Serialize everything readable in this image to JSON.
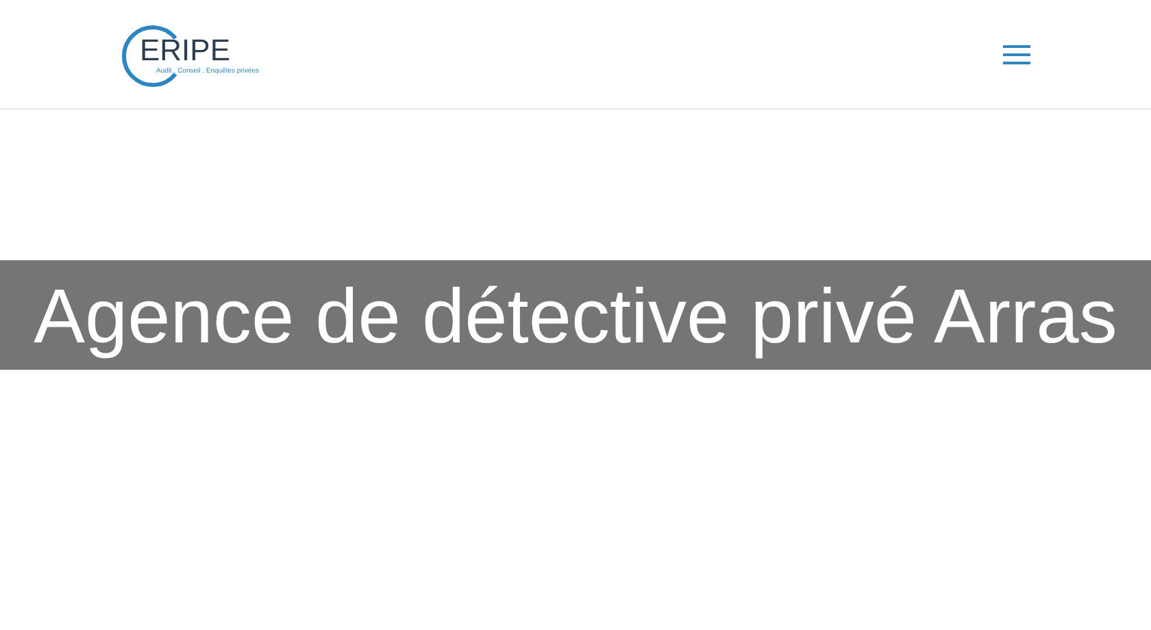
{
  "header": {
    "logo": {
      "wordmark": "ERIPE",
      "tagline": "Audit . Conseil . Enquêtes privées"
    }
  },
  "hero": {
    "title": "Agence de détective privé Arras"
  }
}
